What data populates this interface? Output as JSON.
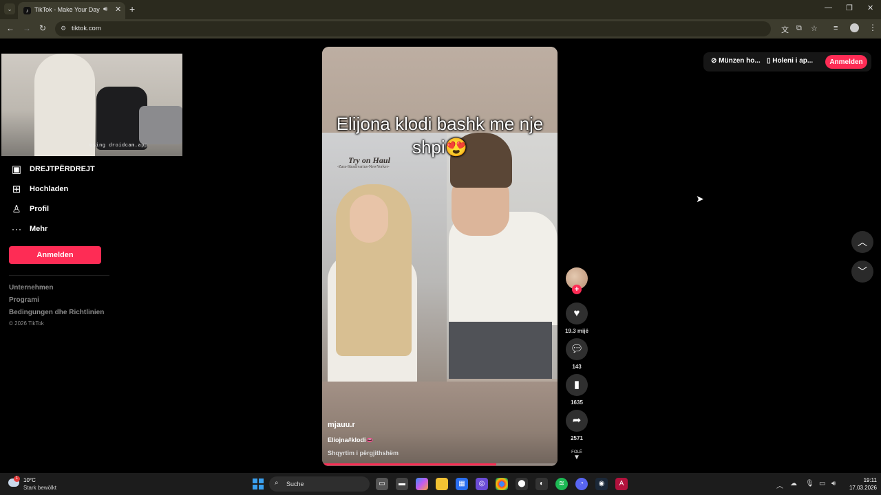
{
  "browser": {
    "tab_title": "TikTok - Make Your Day",
    "url": "tiktok.com"
  },
  "webcam": {
    "watermark": "using droidcam.app"
  },
  "sidebar": {
    "items": [
      {
        "label": "DREJTPËRDREJT",
        "icon": "live-icon"
      },
      {
        "label": "Hochladen",
        "icon": "upload-icon"
      },
      {
        "label": "Profil",
        "icon": "profile-icon"
      },
      {
        "label": "Mehr",
        "icon": "more-icon"
      }
    ],
    "login_label": "Anmelden",
    "footer_links": [
      "Unternehmen",
      "Programi",
      "Bedingungen dhe Richtlinien"
    ],
    "copyright": "© 2026 TikTok"
  },
  "video": {
    "caption": "Elijona klodi bashk me nje shpi😍",
    "overlay_title": "Try on Haul",
    "overlay_subtitle": "-Zara-Stradivarius-NewYorker-",
    "username": "mjauu.r",
    "description": "Eliojna#klodi👄",
    "translate_label": "Shqyrtim i përgjithshëm",
    "progress": 0.74
  },
  "actions": {
    "likes": "19.3 mijë",
    "comments": "143",
    "saves": "1635",
    "shares": "2571",
    "scroll_hint": "FOLË"
  },
  "top_right": {
    "coins_label": "Münzen ho...",
    "app_label": "Holeni i ap...",
    "login_label": "Anmelden"
  },
  "taskbar": {
    "weather_temp": "10°C",
    "weather_desc": "Stark bewölkt",
    "weather_badge": "1",
    "search_label": "Suche",
    "time": "19:11",
    "date": "17.03.2026"
  },
  "colors": {
    "accent": "#fe2c55",
    "background": "#000000"
  }
}
